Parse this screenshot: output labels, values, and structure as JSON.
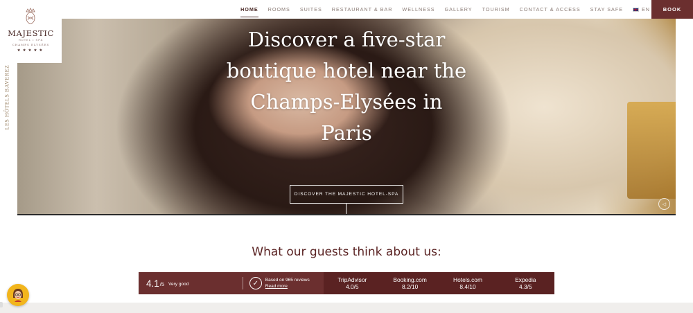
{
  "nav": {
    "items": [
      "HOME",
      "ROOMS",
      "SUITES",
      "RESTAURANT & BAR",
      "WELLNESS",
      "GALLERY",
      "TOURISM",
      "CONTACT & ACCESS",
      "STAY SAFE"
    ],
    "active": "HOME",
    "language": "EN",
    "book_label": "BOOK"
  },
  "logo": {
    "name": "MAJESTIC",
    "subtitle": "HOTEL • SPA",
    "location": "CHAMPS ELYSÉES",
    "stars": "★★★★★"
  },
  "side_brand": "LES HÔTELS BAVEREZ",
  "hero": {
    "title_lines": [
      "Discover a five-star",
      "boutique hotel near the",
      "Champs-Elysées in",
      "Paris"
    ],
    "cta_label": "DISCOVER THE MAJESTIC HOTEL-SPA"
  },
  "reviews": {
    "heading": "What our guests think about us:",
    "score": "4.1",
    "score_max": "/5",
    "score_label": "Very good",
    "based_on": "Based on 965 reviews",
    "read_more": "Read more",
    "sites": [
      {
        "name": "TripAdvisor",
        "score": "4.0/5"
      },
      {
        "name": "Booking.com",
        "score": "8.2/10"
      },
      {
        "name": "Hotels.com",
        "score": "8.4/10"
      },
      {
        "name": "Expedia",
        "score": "4.3/5"
      }
    ]
  },
  "colors": {
    "brand": "#6b2f2f",
    "heading": "#5b2424",
    "chat_bg": "#f2b51c"
  }
}
